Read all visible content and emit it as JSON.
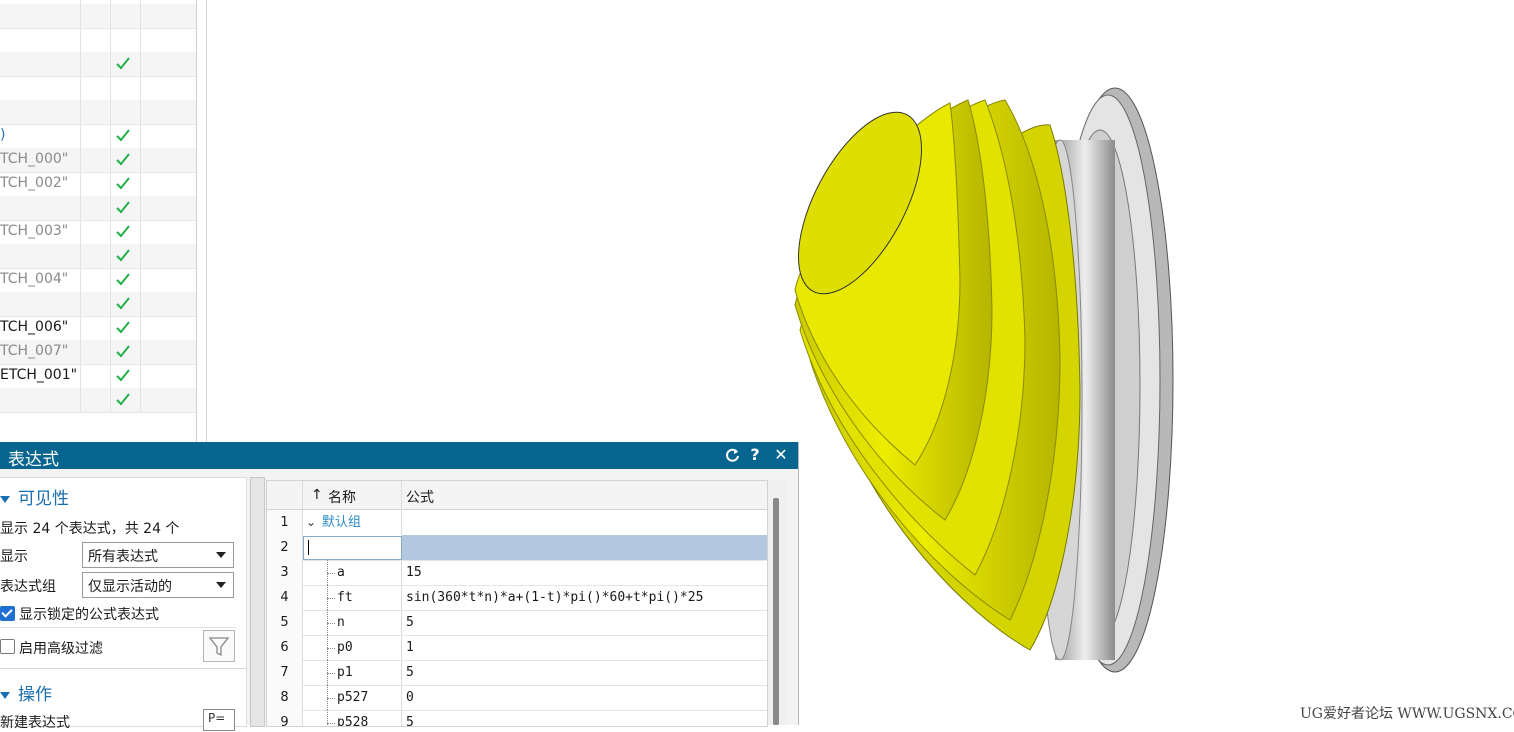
{
  "navigator": {
    "rows": [
      {
        "text": "",
        "check": false
      },
      {
        "text": "",
        "check": false
      },
      {
        "text": "",
        "check": false
      },
      {
        "text": "",
        "check": true
      },
      {
        "text": "",
        "check": false
      },
      {
        "text": "",
        "check": false
      },
      {
        "text": ")",
        "check": true,
        "style": "blue"
      },
      {
        "text": "TCH_000\"",
        "check": true,
        "style": "gray"
      },
      {
        "text": "TCH_002\"",
        "check": true,
        "style": "gray"
      },
      {
        "text": "",
        "check": true
      },
      {
        "text": "TCH_003\"",
        "check": true,
        "style": "gray"
      },
      {
        "text": "",
        "check": true
      },
      {
        "text": "TCH_004\"",
        "check": true,
        "style": "gray"
      },
      {
        "text": "",
        "check": true
      },
      {
        "text": "TCH_006\"",
        "check": true,
        "style": "dark"
      },
      {
        "text": "TCH_007\"",
        "check": true,
        "style": "gray"
      },
      {
        "text": "ETCH_001\"",
        "check": true,
        "style": "dark"
      },
      {
        "text": "",
        "check": true
      }
    ]
  },
  "dialog": {
    "title": "表达式",
    "refresh_icon": "refresh-icon",
    "help_label": "?",
    "close_label": "✕",
    "visibility": {
      "header": "可见性",
      "summary": "显示 24 个表达式，共 24 个",
      "show_label": "显示",
      "show_value": "所有表达式",
      "group_label": "表达式组",
      "group_value": "仅显示活动的",
      "locked_label": "显示锁定的公式表达式",
      "locked_checked": true,
      "advanced_label": "启用高级过滤",
      "advanced_checked": false
    },
    "operations": {
      "header": "操作",
      "new_label": "新建表达式"
    },
    "table": {
      "sort_arrow": "↑",
      "col_name": "名称",
      "col_formula": "公式",
      "rows": [
        {
          "num": "1",
          "name": "默认组",
          "formula": "",
          "kind": "group"
        },
        {
          "num": "2",
          "name": "",
          "formula": "",
          "kind": "edit"
        },
        {
          "num": "3",
          "name": "a",
          "formula": "15"
        },
        {
          "num": "4",
          "name": "ft",
          "formula": "sin(360*t*n)*a+(1-t)*pi()*60+t*pi()*25"
        },
        {
          "num": "5",
          "name": "n",
          "formula": "5"
        },
        {
          "num": "6",
          "name": "p0",
          "formula": "1"
        },
        {
          "num": "7",
          "name": "p1",
          "formula": "5"
        },
        {
          "num": "8",
          "name": "p527",
          "formula": "0"
        },
        {
          "num": "9",
          "name": "p528",
          "formula": "5"
        }
      ]
    }
  },
  "model": {
    "accent": "#e6e600",
    "flange": "#d9d9d9"
  },
  "watermark": "UG爱好者论坛 WWW.UGSNX.COM"
}
